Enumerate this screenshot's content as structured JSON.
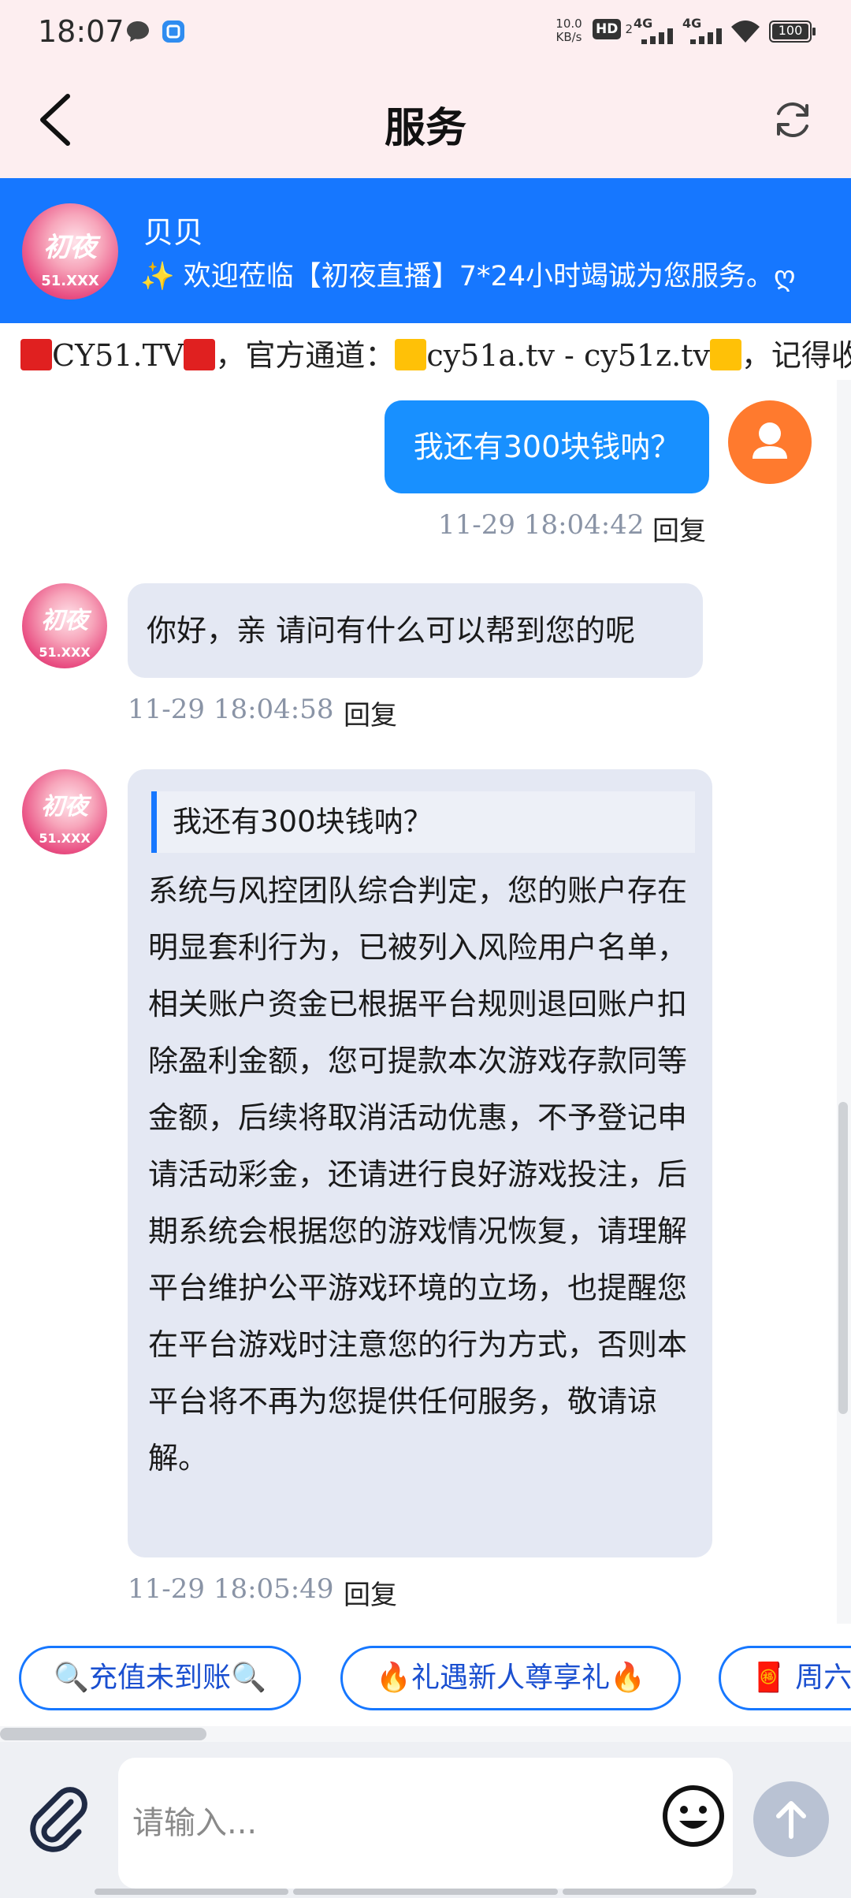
{
  "status_bar": {
    "time": "18:07",
    "net_speed_top": "10.0",
    "net_speed_unit": "KB/s",
    "hd_label": "HD",
    "hd_sub": "2",
    "sig1": "4G",
    "sig2": "4G",
    "battery": "100"
  },
  "nav": {
    "title": "服务"
  },
  "agent": {
    "name": "贝贝",
    "greeting": "✨ 欢迎莅临【初夜直播】7*24小时竭诚为您服务。ღ",
    "avatar_text_top": "初夜",
    "avatar_text_bottom": "51.XXX"
  },
  "marquee": {
    "part1": "CY51.TV",
    "part2": "，官方通道：",
    "part3": "cy51a.tv - cy51z.tv",
    "part4": "，记得收"
  },
  "messages": {
    "user_msg": "我还有300块钱呐？",
    "user_time": "11-29 18:04:42",
    "reply_label": "回复",
    "bot1_text": "你好，亲 请问有什么可以帮到您的呢",
    "bot1_time": "11-29 18:04:58",
    "bot2_quote": "我还有300块钱呐？",
    "bot2_text": "系统与风控团队综合判定，您的账户存在明显套利行为，已被列入风险用户名单，相关账户资金已根据平台规则退回账户扣除盈利金额，您可提款本次游戏存款同等金额，后续将取消活动优惠，不予登记申请活动彩金，还请进行良好游戏投注，后期系统会根据您的游戏情况恢复，请理解平台维护公平游戏环境的立场，也提醒您在平台游戏时注意您的行为方式，否则本平台将不再为您提供任何服务，敬请谅解。",
    "bot2_time": "11-29 18:05:49"
  },
  "quick_replies": [
    "🔍充值未到账🔍",
    "🔥礼遇新人尊享礼🔥",
    "🧧 周六"
  ],
  "input": {
    "placeholder": "请输入..."
  },
  "colors": {
    "primary": "#1677ff",
    "user_avatar": "#ff7a2e",
    "bot_bubble": "#e4e8f3"
  }
}
